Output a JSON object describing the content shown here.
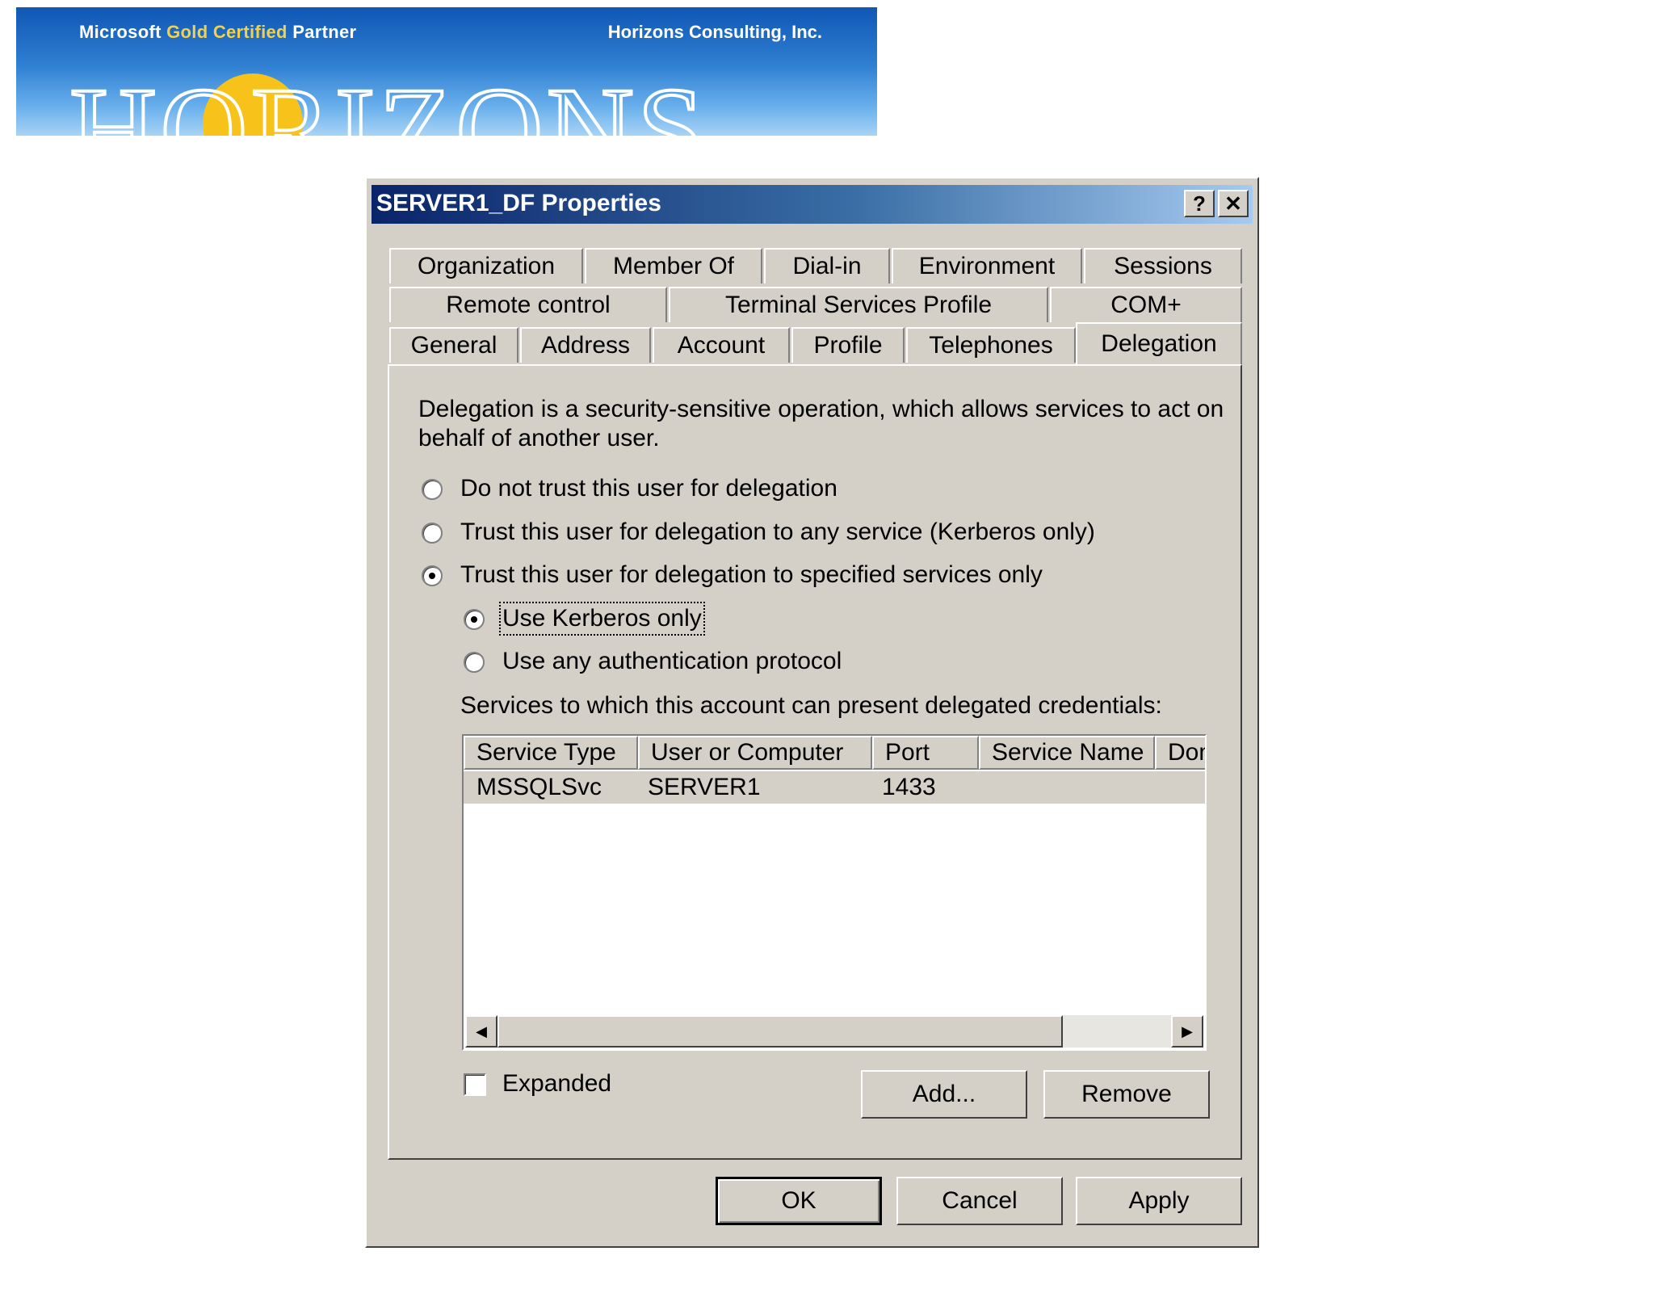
{
  "banner": {
    "microsoft": "Microsoft",
    "gold_certified": "Gold Certified",
    "partner": "Partner",
    "company": "Horizons Consulting, Inc.",
    "wordmark": "HORIZONS"
  },
  "window": {
    "title": "SERVER1_DF Properties",
    "help_label": "?",
    "close_label": "✕"
  },
  "tabs": {
    "row1": [
      "Organization",
      "Member Of",
      "Dial-in",
      "Environment",
      "Sessions"
    ],
    "row2": [
      "Remote control",
      "Terminal Services Profile",
      "COM+"
    ],
    "row3": [
      "General",
      "Address",
      "Account",
      "Profile",
      "Telephones",
      "Delegation"
    ],
    "active": "Delegation"
  },
  "delegation": {
    "description": "Delegation is a security-sensitive operation, which allows services to act on behalf of another user.",
    "options": [
      {
        "label": "Do not trust this user for delegation",
        "selected": false
      },
      {
        "label": "Trust this user for delegation to any service (Kerberos only)",
        "selected": false
      },
      {
        "label": "Trust this user for delegation to specified services only",
        "selected": true
      }
    ],
    "sub_options": [
      {
        "label": "Use Kerberos only",
        "selected": true
      },
      {
        "label": "Use any authentication protocol",
        "selected": false
      }
    ],
    "services_label": "Services to which this account can present delegated credentials:",
    "columns": [
      "Service Type",
      "User or Computer",
      "Port",
      "Service Name",
      "Domain"
    ],
    "rows": [
      {
        "service_type": "MSSQLSvc",
        "user_or_computer": "SERVER1",
        "port": "1433",
        "service_name": "",
        "domain": ""
      }
    ],
    "expanded_label": "Expanded",
    "expanded_checked": false,
    "add_label": "Add...",
    "remove_label": "Remove"
  },
  "footer": {
    "ok_label": "OK",
    "cancel_label": "Cancel",
    "apply_label": "Apply"
  }
}
